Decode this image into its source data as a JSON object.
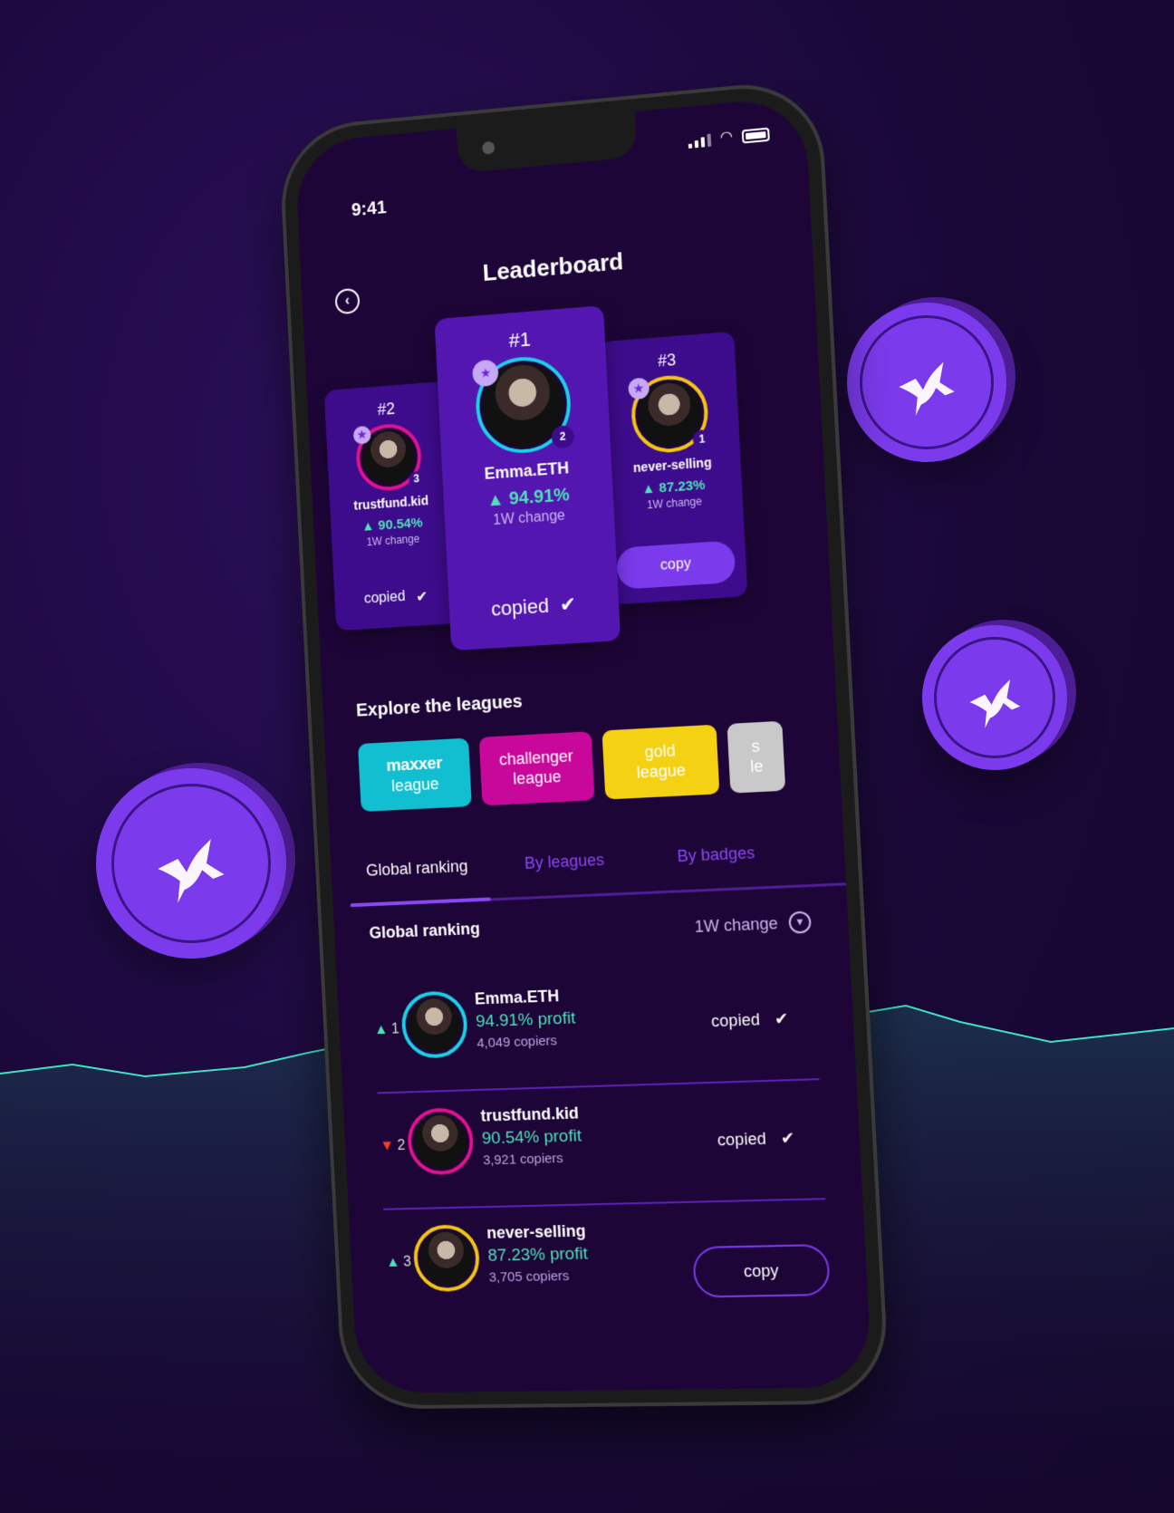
{
  "status_bar": {
    "time": "9:41",
    "icons": [
      "signal-icon",
      "wifi-icon",
      "battery-icon"
    ]
  },
  "header": {
    "title": "Leaderboard",
    "back_icon": "chevron-left-icon"
  },
  "podium": [
    {
      "rank": "#2",
      "name": "trustfund.kid",
      "change": "90.54%",
      "change_label": "1W change",
      "position_badge": "3",
      "ring_color": "#e0128e",
      "status": "copied"
    },
    {
      "rank": "#1",
      "name": "Emma.ETH",
      "change": "94.91%",
      "change_label": "1W change",
      "position_badge": "2",
      "ring_color": "#1ad1e5",
      "status": "copied"
    },
    {
      "rank": "#3",
      "name": "never-selling",
      "change": "87.23%",
      "change_label": "1W change",
      "position_badge": "1",
      "ring_color": "#f2c60f",
      "action": "copy"
    }
  ],
  "leagues_section": {
    "title": "Explore the leagues",
    "items": [
      {
        "line1": "maxxer",
        "line2": "league",
        "color": "#12bfd0"
      },
      {
        "line1": "challenger",
        "line2": "league",
        "color": "#c8089a"
      },
      {
        "line1": "gold",
        "line2": "league",
        "color": "#f5d114"
      },
      {
        "line1": "s",
        "line2": "le",
        "color": "#c9c9c9"
      }
    ]
  },
  "tabs": [
    {
      "label": "Global ranking",
      "active": true
    },
    {
      "label": "By leagues",
      "active": false
    },
    {
      "label": "By badges",
      "active": false
    }
  ],
  "ranking": {
    "title": "Global ranking",
    "sort_label": "1W change",
    "rows": [
      {
        "trend": "up",
        "position": "1",
        "name": "Emma.ETH",
        "profit": "94.91% profit",
        "copiers": "4,049 copiers",
        "status": "copied",
        "ring_color": "#1ad1e5"
      },
      {
        "trend": "down",
        "position": "2",
        "name": "trustfund.kid",
        "profit": "90.54% profit",
        "copiers": "3,921 copiers",
        "status": "copied",
        "ring_color": "#e0128e"
      },
      {
        "trend": "up",
        "position": "3",
        "name": "never-selling",
        "profit": "87.23% profit",
        "copiers": "3,705 copiers",
        "action": "copy",
        "ring_color": "#f2c60f"
      }
    ]
  },
  "colors": {
    "background": "#1a0838",
    "screen": "#1e0538",
    "accent": "#7c3aed",
    "positive": "#4ee0b8",
    "negative": "#ff3b1f"
  }
}
